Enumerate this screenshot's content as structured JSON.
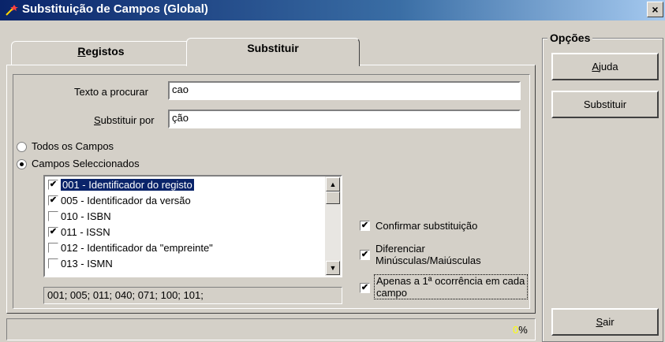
{
  "window": {
    "title": "Substituição de Campos (Global)",
    "close": "×"
  },
  "tabs": [
    {
      "pre": "",
      "u": "R",
      "post": "egistos"
    },
    {
      "label": "Substituir"
    }
  ],
  "form": {
    "search_label_pre": "Texto a procurar",
    "search_value": "cao",
    "replace_u": "S",
    "replace_label_post": "ubstituir por",
    "replace_value": "ção"
  },
  "scope": {
    "all_fields": "Todos os Campos",
    "selected_fields": "Campos Seleccionados",
    "selected": "selected_fields"
  },
  "fields_list": [
    {
      "label": "001 - Identificador do registo",
      "checked": true,
      "selected": true
    },
    {
      "label": "005 - Identificador da versão",
      "checked": true,
      "selected": false
    },
    {
      "label": "010 - ISBN",
      "checked": false,
      "selected": false
    },
    {
      "label": "011 - ISSN",
      "checked": true,
      "selected": false
    },
    {
      "label": "012 - Identificador da \"empreinte\"",
      "checked": false,
      "selected": false
    },
    {
      "label": "013 - ISMN",
      "checked": false,
      "selected": false
    }
  ],
  "selected_summary": "001; 005; 011; 040; 071; 100; 101;",
  "options_checks": [
    {
      "label": "Confirmar substituição",
      "checked": true
    },
    {
      "label": "Diferenciar Minúsculas/Maiúsculas",
      "checked": true
    },
    {
      "label": "Apenas a 1ª ocorrência em cada campo",
      "checked": true
    }
  ],
  "side": {
    "group_title": "Opções",
    "help_u": "A",
    "help_post": "juda",
    "replace_button": "Substituir",
    "exit_u": "S",
    "exit_post": "air"
  },
  "status": {
    "progress_value": "0",
    "progress_unit": "%"
  },
  "icons": {
    "app": "wand-icon",
    "close": "close-icon",
    "scroll_up": "arrow-up-icon",
    "scroll_down": "arrow-down-icon"
  },
  "colors": {
    "title_bar": "#0a246a",
    "selection": "#0a246a",
    "progress_text": "#ffff00"
  }
}
